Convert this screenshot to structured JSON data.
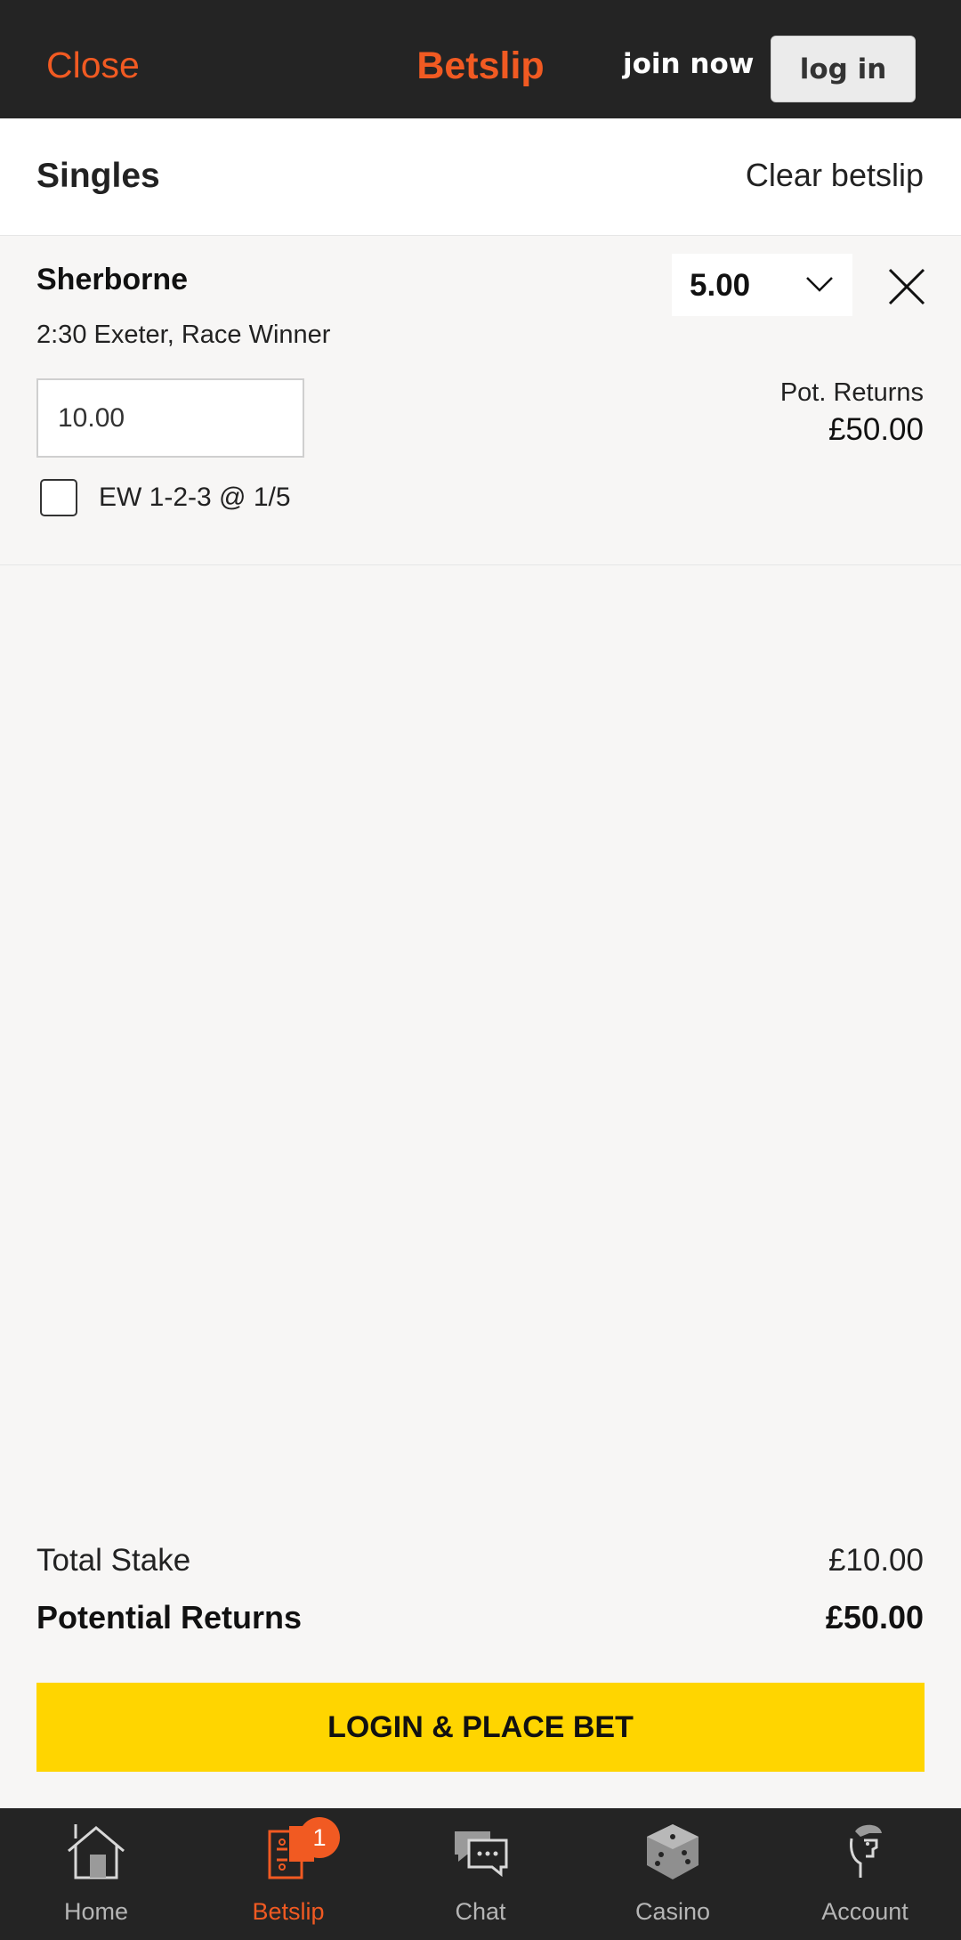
{
  "header": {
    "close_label": "Close",
    "title": "Betslip",
    "join_label": "join now",
    "login_label": "log in"
  },
  "singles": {
    "title": "Singles",
    "clear_label": "Clear betslip"
  },
  "selection": {
    "name": "Sherborne",
    "market": "2:30 Exeter, Race Winner",
    "odds": "5.00",
    "stake": "10.00",
    "pot_returns_label": "Pot. Returns",
    "pot_returns_value": "£50.00",
    "each_way_label": "EW 1-2-3 @ 1/5",
    "each_way_checked": false
  },
  "totals": {
    "total_stake_label": "Total Stake",
    "total_stake_value": "£10.00",
    "potential_returns_label": "Potential Returns",
    "potential_returns_value": "£50.00"
  },
  "place_bet_label": "LOGIN & PLACE BET",
  "colors": {
    "brand_orange": "#f15a22",
    "header_bg": "#242424",
    "cta_yellow": "#ffd500"
  },
  "nav": {
    "items": [
      {
        "label": "Home",
        "icon": "home-icon"
      },
      {
        "label": "Betslip",
        "icon": "betslip-icon",
        "badge": "1",
        "active": true
      },
      {
        "label": "Chat",
        "icon": "chat-icon"
      },
      {
        "label": "Casino",
        "icon": "dice-icon"
      },
      {
        "label": "Account",
        "icon": "account-icon"
      }
    ]
  }
}
